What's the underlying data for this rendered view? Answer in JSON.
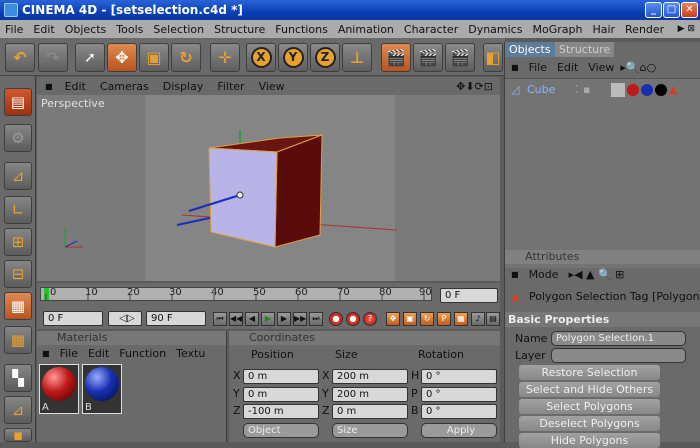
{
  "app": {
    "title": "CINEMA 4D - [setselection.c4d *]"
  },
  "menu": [
    "File",
    "Edit",
    "Objects",
    "Tools",
    "Selection",
    "Structure",
    "Functions",
    "Animation",
    "Character",
    "Dynamics",
    "MoGraph",
    "Hair",
    "Render"
  ],
  "toolbar": {
    "x_label": "X",
    "y_label": "Y",
    "z_label": "Z"
  },
  "viewport": {
    "menu": [
      "Edit",
      "Cameras",
      "Display",
      "Filter",
      "View"
    ],
    "label": "Perspective"
  },
  "timeline": {
    "ticks": [
      "0",
      "10",
      "20",
      "30",
      "40",
      "50",
      "60",
      "70",
      "80",
      "90"
    ],
    "frame_field": "0 F"
  },
  "frame_controls": {
    "start": "0 F",
    "end": "90 F"
  },
  "materials": {
    "title": "Materials",
    "menu": [
      "File",
      "Edit",
      "Function",
      "Textu"
    ],
    "items": [
      {
        "label": "A",
        "color": "#c01818"
      },
      {
        "label": "B",
        "color": "#1830b0"
      }
    ]
  },
  "coordinates": {
    "title": "Coordinates",
    "headers": [
      "Position",
      "Size",
      "Rotation"
    ],
    "rows": [
      {
        "axis": "X",
        "pos": "0 m",
        "size_axis": "X",
        "size": "200 m",
        "rot_axis": "H",
        "rot": "0 °"
      },
      {
        "axis": "Y",
        "pos": "0 m",
        "size_axis": "Y",
        "size": "200 m",
        "rot_axis": "P",
        "rot": "0 °"
      },
      {
        "axis": "Z",
        "pos": "-100 m",
        "size_axis": "Z",
        "size": "0 m",
        "rot_axis": "B",
        "rot": "0 °"
      }
    ],
    "mode": "Object",
    "size_mode": "Size",
    "apply": "Apply"
  },
  "objects": {
    "tabs": [
      "Objects",
      "Structure"
    ],
    "menu": [
      "File",
      "Edit",
      "View"
    ],
    "item": "Cube"
  },
  "attributes": {
    "title": "Attributes",
    "mode": "Mode",
    "tag": "Polygon Selection Tag [Polygon",
    "section": "Basic Properties",
    "name_label": "Name",
    "name_value": "Polygon Selection.1",
    "layer_label": "Layer",
    "buttons": [
      "Restore Selection",
      "Select and Hide Others",
      "Select Polygons",
      "Deselect Polygons",
      "Hide Polygons"
    ]
  }
}
